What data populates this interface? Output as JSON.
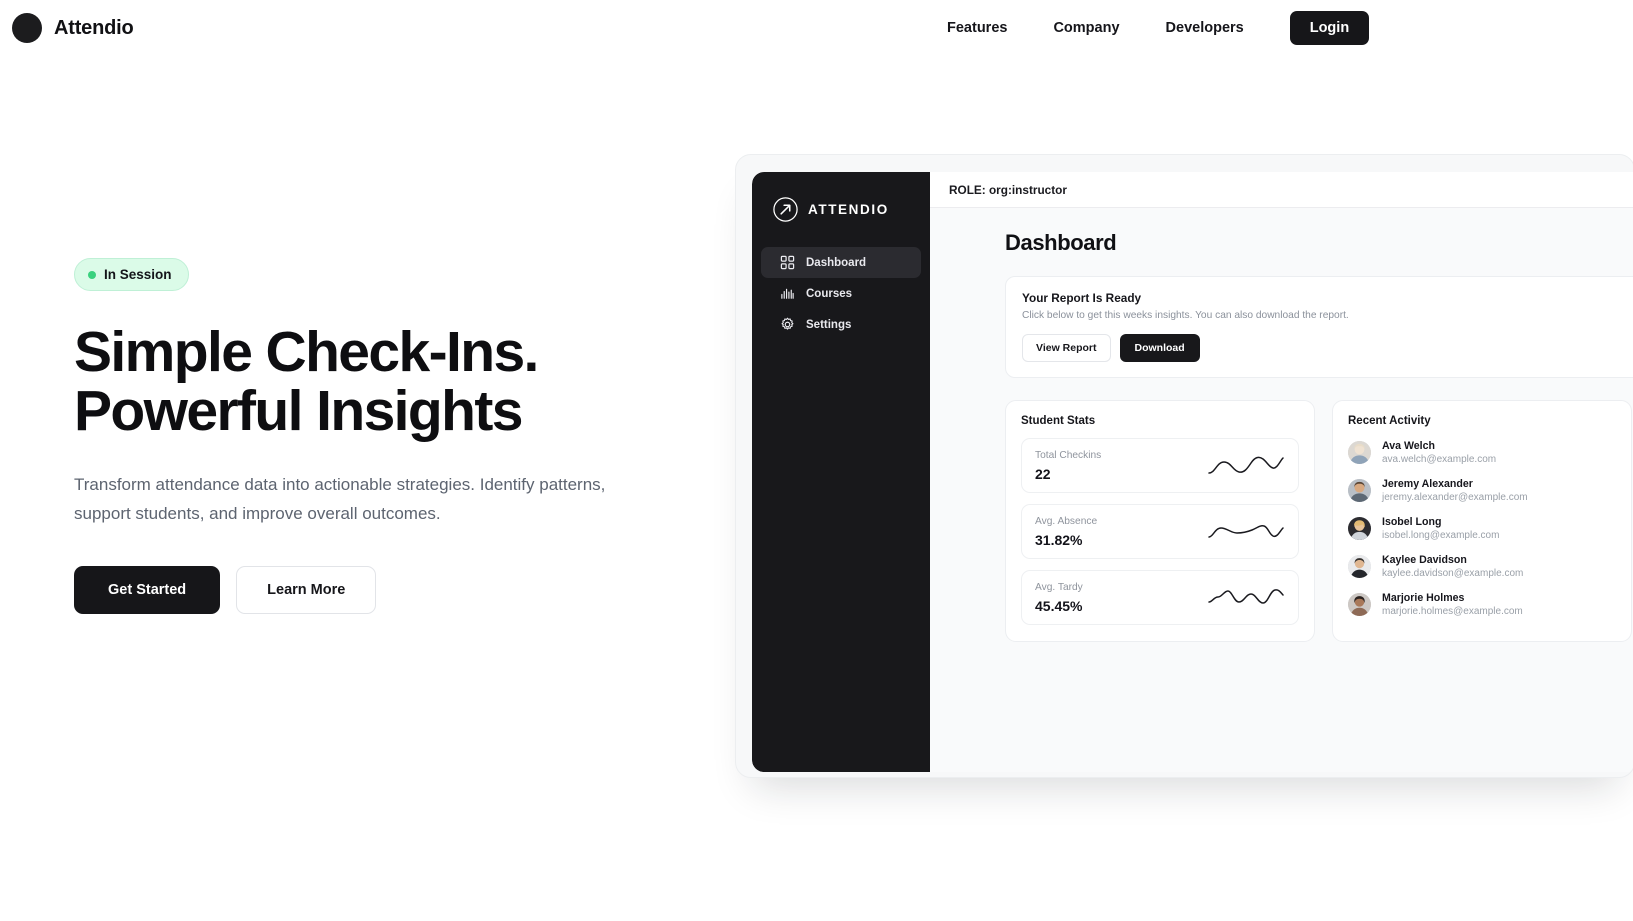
{
  "nav": {
    "brand": "Attendio",
    "links": [
      {
        "label": "Features"
      },
      {
        "label": "Company"
      },
      {
        "label": "Developers"
      }
    ],
    "login_label": "Login"
  },
  "hero": {
    "badge_label": "In Session",
    "headline_line1": "Simple Check-Ins.",
    "headline_line2": "Powerful Insights",
    "subhead": "Transform attendance data into actionable strategies. Identify patterns, support students, and improve overall outcomes.",
    "primary_cta": "Get Started",
    "secondary_cta": "Learn More"
  },
  "dashboard": {
    "logo_text": "ATTENDIO",
    "nav": [
      {
        "label": "Dashboard",
        "icon": "grid-icon",
        "active": true
      },
      {
        "label": "Courses",
        "icon": "bar-chart-icon",
        "active": false
      },
      {
        "label": "Settings",
        "icon": "gear-icon",
        "active": false
      }
    ],
    "role": "ROLE: org:instructor",
    "page_title": "Dashboard",
    "report": {
      "title": "Your Report Is Ready",
      "subtitle": "Click below to get this weeks insights. You can also download the report.",
      "view_label": "View Report",
      "download_label": "Download"
    },
    "student_stats": {
      "title": "Student Stats",
      "rows": [
        {
          "label": "Total Checkins",
          "value": "22"
        },
        {
          "label": "Avg. Absence",
          "value": "31.82%"
        },
        {
          "label": "Avg. Tardy",
          "value": "45.45%"
        }
      ]
    },
    "recent_activity": {
      "title": "Recent Activity",
      "items": [
        {
          "name": "Ava Welch",
          "email": "ava.welch@example.com"
        },
        {
          "name": "Jeremy Alexander",
          "email": "jeremy.alexander@example.com"
        },
        {
          "name": "Isobel Long",
          "email": "isobel.long@example.com"
        },
        {
          "name": "Kaylee Davidson",
          "email": "kaylee.davidson@example.com"
        },
        {
          "name": "Marjorie Holmes",
          "email": "marjorie.holmes@example.com"
        }
      ]
    }
  },
  "colors": {
    "ink": "#161619",
    "badge_bg": "#dbfbe8",
    "badge_dot": "#3ad17e",
    "sidebar_bg": "#18181b",
    "muted_text": "#8f949d"
  }
}
